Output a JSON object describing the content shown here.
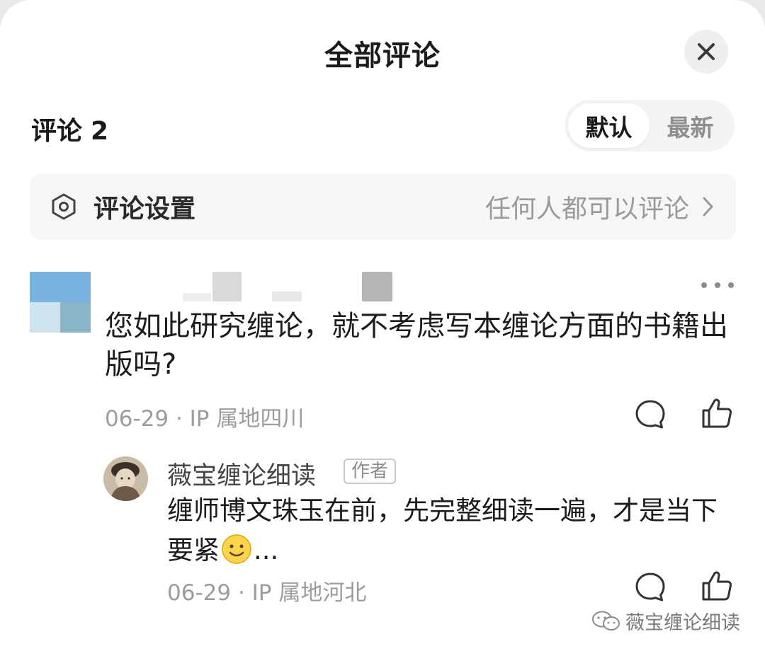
{
  "header": {
    "title": "全部评论",
    "close_icon": "close-icon"
  },
  "comments_count": {
    "label": "评论",
    "count": "2"
  },
  "sort": {
    "options": [
      "默认",
      "最新"
    ],
    "selected": "默认"
  },
  "settings": {
    "label": "评论设置",
    "value": "任何人都可以评论",
    "icon": "settings-hexagon-icon"
  },
  "comments": [
    {
      "text": "您如此研究缠论，就不考虑写本缠论方面的书籍出版吗?",
      "date": "06-29",
      "ip": "IP 属地四川",
      "replies": [
        {
          "name": "薇宝缠论细读",
          "badge": "作者",
          "text": "缠师博文珠玉在前，先完整细读一遍，才是当下要紧",
          "trail": "...",
          "date": "06-29",
          "ip": "IP 属地河北"
        }
      ]
    }
  ],
  "watermark": {
    "text": "薇宝缠论细读"
  },
  "colors": {
    "background": "#ffffff",
    "muted": "#9c9c9c",
    "settings_bg": "#f6f6f6"
  }
}
